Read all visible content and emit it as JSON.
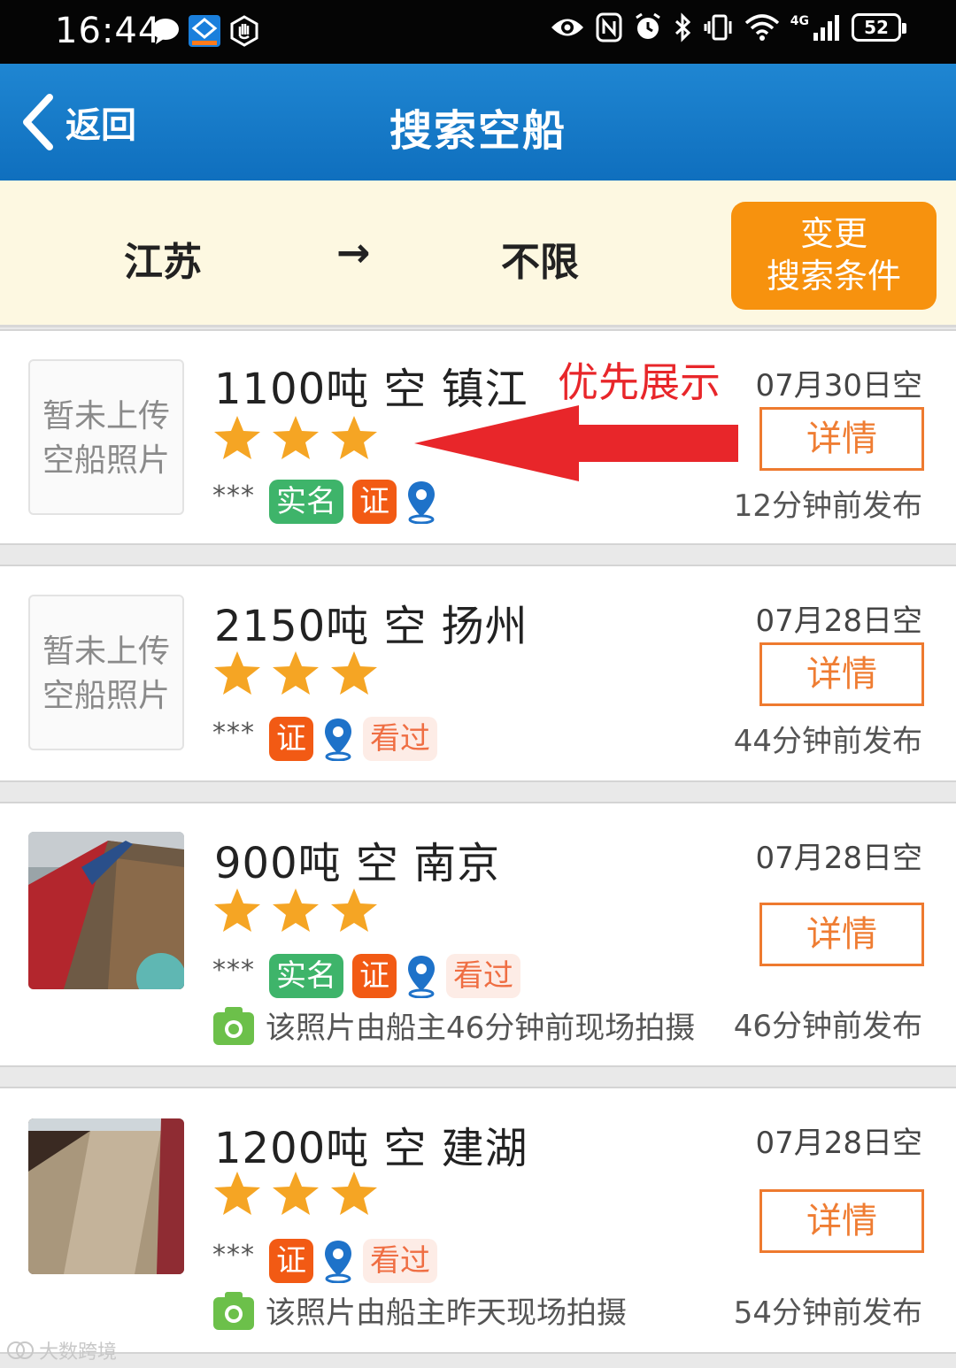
{
  "status_bar": {
    "time": "16:44",
    "network": "4G",
    "battery": "52"
  },
  "nav": {
    "back_label": "返回",
    "title": "搜索空船"
  },
  "route": {
    "from": "江苏",
    "arrow": "→",
    "to": "不限",
    "change_button_line1": "变更",
    "change_button_line2": "搜索条件"
  },
  "annotation": {
    "label": "优先展示",
    "color": "#e8262a"
  },
  "listings": [
    {
      "title": "1100吨 空 镇江",
      "rating": 3,
      "masked_name": "***",
      "tags": [
        "实名",
        "证"
      ],
      "seen": "",
      "date": "07月30日空",
      "detail_label": "详情",
      "published": "12分钟前发布",
      "photo_placeholder_line1": "暂未上传",
      "photo_placeholder_line2": "空船照片",
      "photo_note": ""
    },
    {
      "title": "2150吨 空 扬州",
      "rating": 3,
      "masked_name": "***",
      "tags": [
        "证"
      ],
      "seen": "看过",
      "date": "07月28日空",
      "detail_label": "详情",
      "published": "44分钟前发布",
      "photo_placeholder_line1": "暂未上传",
      "photo_placeholder_line2": "空船照片",
      "photo_note": ""
    },
    {
      "title": "900吨 空 南京",
      "rating": 3,
      "masked_name": "***",
      "tags": [
        "实名",
        "证"
      ],
      "seen": "看过",
      "date": "07月28日空",
      "detail_label": "详情",
      "published": "46分钟前发布",
      "photo_note": "该照片由船主46分钟前现场拍摄"
    },
    {
      "title": "1200吨 空 建湖",
      "rating": 3,
      "masked_name": "***",
      "tags": [
        "证"
      ],
      "seen": "看过",
      "date": "07月28日空",
      "detail_label": "详情",
      "published": "54分钟前发布",
      "photo_note": "该照片由船主昨天现场拍摄"
    }
  ],
  "watermark": "大数跨境",
  "colors": {
    "nav_blue": "#1677c8",
    "accent_orange": "#f7920e",
    "tag_green": "#3eb46a",
    "tag_orange": "#f25a14",
    "star": "#f5a524"
  }
}
